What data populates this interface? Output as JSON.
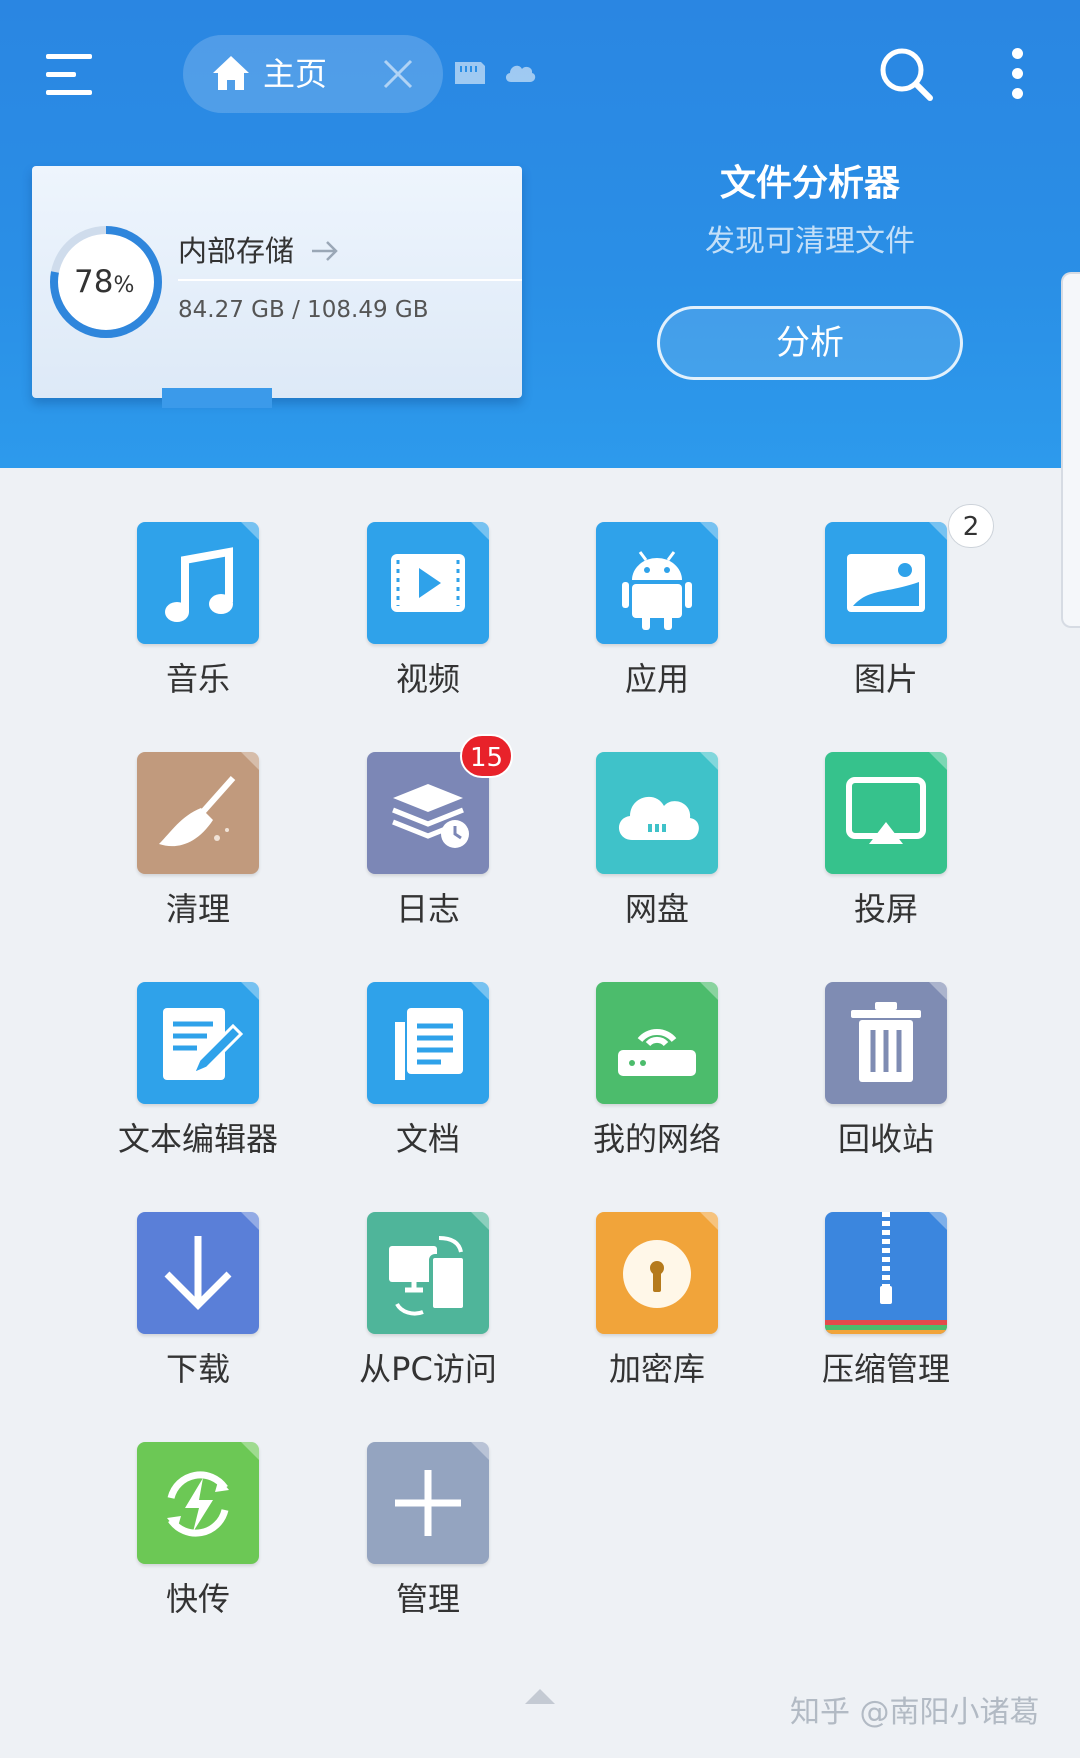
{
  "header": {
    "home_tab_label": "主页",
    "storage": {
      "title": "内部存储",
      "percent_value": "78",
      "percent_sign": "%",
      "used_fraction": 0.78,
      "usage": "84.27 GB / 108.49 GB"
    },
    "analyzer": {
      "title": "文件分析器",
      "subtitle": "发现可清理文件",
      "button_label": "分析"
    }
  },
  "grid": {
    "items": [
      {
        "label": "音乐",
        "icon": "music-icon",
        "color": "#2fa2ea"
      },
      {
        "label": "视频",
        "icon": "video-icon",
        "color": "#2fa2ea"
      },
      {
        "label": "应用",
        "icon": "android-icon",
        "color": "#2fa2ea"
      },
      {
        "label": "图片",
        "icon": "picture-icon",
        "color": "#2fa2ea",
        "badge": "2"
      },
      {
        "label": "清理",
        "icon": "broom-icon",
        "color": "#c19a7d"
      },
      {
        "label": "日志",
        "icon": "log-icon",
        "color": "#7c87b6",
        "badge": "15"
      },
      {
        "label": "网盘",
        "icon": "cloud-drive-icon",
        "color": "#3fc2c9"
      },
      {
        "label": "投屏",
        "icon": "cast-icon",
        "color": "#36c28c"
      },
      {
        "label": "文本编辑器",
        "icon": "text-editor-icon",
        "color": "#2fa2ea"
      },
      {
        "label": "文档",
        "icon": "document-icon",
        "color": "#2fa2ea"
      },
      {
        "label": "我的网络",
        "icon": "network-icon",
        "color": "#4cbc6c"
      },
      {
        "label": "回收站",
        "icon": "trash-icon",
        "color": "#7f8cb3"
      },
      {
        "label": "下载",
        "icon": "download-icon",
        "color": "#5a7fd8"
      },
      {
        "label": "从PC访问",
        "icon": "pc-access-icon",
        "color": "#4fb59a"
      },
      {
        "label": "加密库",
        "icon": "vault-icon",
        "color": "#f1a43a"
      },
      {
        "label": "压缩管理",
        "icon": "zip-icon",
        "color": "#3b86de"
      },
      {
        "label": "快传",
        "icon": "quick-send-icon",
        "color": "#6cc855"
      },
      {
        "label": "管理",
        "icon": "add-icon",
        "color": "#94a4c0"
      }
    ]
  },
  "watermark": "知乎 @南阳小诸葛",
  "colors": {
    "header_blue": "#2a8fe6",
    "ring_blue": "#2f86dc",
    "badge_red": "#e8222a",
    "background": "#eef1f5"
  }
}
